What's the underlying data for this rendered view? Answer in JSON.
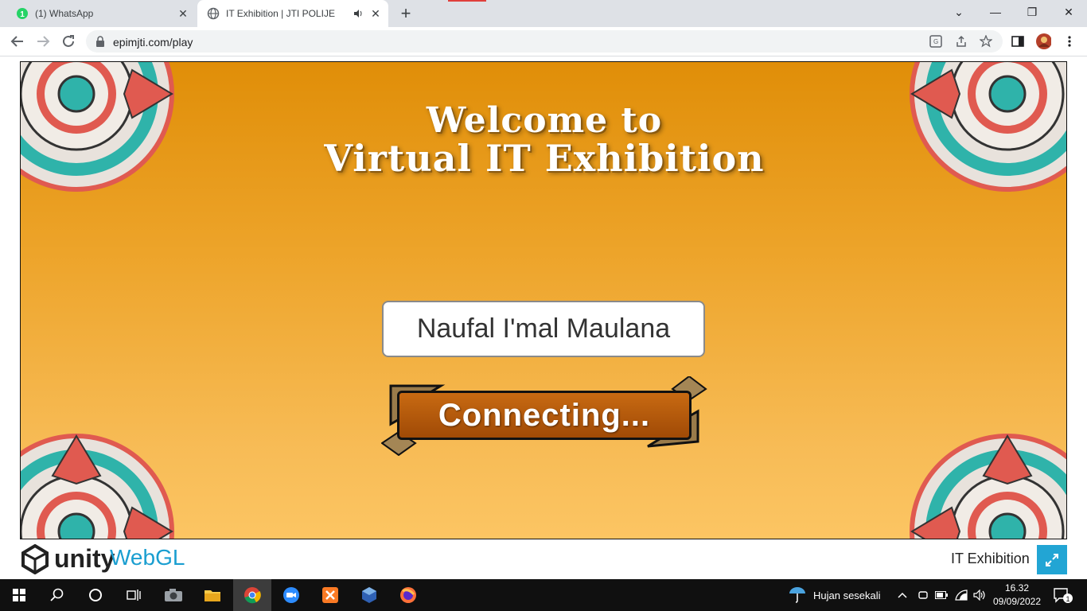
{
  "browser": {
    "tabs": [
      {
        "title": "(1) WhatsApp",
        "badge": "1",
        "active": false
      },
      {
        "title": "IT Exhibition | JTI POLIJE",
        "active": true
      }
    ],
    "url": "epimjti.com/play",
    "brand_color": "#1a73e8"
  },
  "game": {
    "welcome_line1": "Welcome to",
    "welcome_line2": "Virtual IT Exhibition",
    "player_name": "Naufal I'mal Maulana",
    "connect_label": "Connecting..."
  },
  "unity_footer": {
    "unity_label": "unity",
    "webgl_label": "WebGL",
    "title": "IT Exhibition",
    "accent_color": "#22a5d4"
  },
  "taskbar": {
    "weather": "Hujan sesekali",
    "time": "16.32",
    "date": "09/09/2022",
    "notification_count": "1",
    "apps": [
      "start-icon",
      "search-icon",
      "cortana-icon",
      "task-view-icon",
      "camera-app-icon",
      "file-explorer-icon",
      "chrome-icon",
      "zoom-icon",
      "xampp-icon",
      "virtualbox-icon",
      "firefox-icon"
    ]
  }
}
